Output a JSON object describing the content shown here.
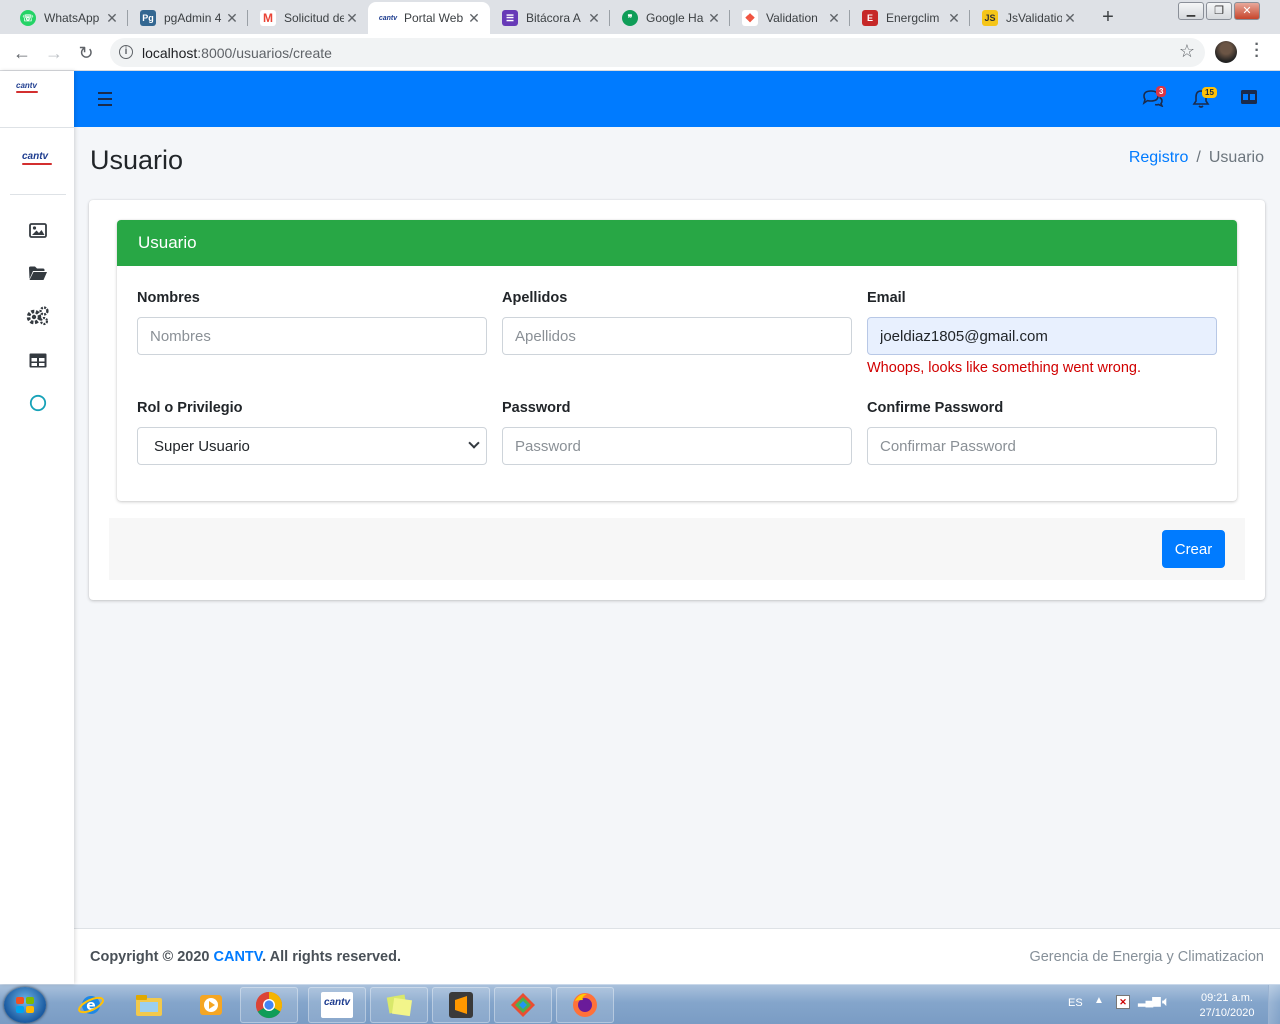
{
  "browser": {
    "tabs": [
      {
        "title": "WhatsApp",
        "icon": "whatsapp-icon",
        "color": "#25d366"
      },
      {
        "title": "pgAdmin 4",
        "icon": "pgadmin-icon",
        "color": "#336791"
      },
      {
        "title": "Solicitud de",
        "icon": "gmail-icon",
        "color": "#ea4335"
      },
      {
        "title": "Portal Web",
        "icon": "cantv-icon",
        "color": "#1d3c8f"
      },
      {
        "title": "Bitácora A",
        "icon": "forms-icon",
        "color": "#673ab7"
      },
      {
        "title": "Google Ha",
        "icon": "hangouts-icon",
        "color": "#0f9d58"
      },
      {
        "title": "Validation",
        "icon": "laravel-icon",
        "color": "#f05340"
      },
      {
        "title": "Energclim",
        "icon": "energclim-icon",
        "color": "#c62828"
      },
      {
        "title": "JsValidatio",
        "icon": "jsvalidation-icon",
        "color": "#f5c518"
      }
    ],
    "url_host": "localhost",
    "url_rest": ":8000/usuarios/create"
  },
  "brand": {
    "logo_text": "cantv"
  },
  "topnav": {
    "messages_badge": "3",
    "notifications_badge": "15"
  },
  "page": {
    "title": "Usuario",
    "breadcrumb": {
      "link": "Registro",
      "current": "Usuario"
    }
  },
  "form": {
    "header": "Usuario",
    "nombres": {
      "label": "Nombres",
      "placeholder": "Nombres",
      "value": ""
    },
    "apellidos": {
      "label": "Apellidos",
      "placeholder": "Apellidos",
      "value": ""
    },
    "email": {
      "label": "Email",
      "value": "joeldiaz1805@gmail.com",
      "error": "Whoops, looks like something went wrong."
    },
    "rol": {
      "label": "Rol o Privilegio",
      "selected": "Super Usuario"
    },
    "password": {
      "label": "Password",
      "placeholder": "Password"
    },
    "confirm": {
      "label": "Confirme Password",
      "placeholder": "Confirmar Password"
    },
    "submit": "Crear"
  },
  "footer": {
    "copyright_prefix": "Copyright © 2020 ",
    "copyright_brand": "CANTV",
    "copyright_suffix": ". All rights reserved.",
    "right": "Gerencia de Energia y Climatizacion"
  },
  "taskbar": {
    "language": "ES",
    "time": "09:21 a.m.",
    "date": "27/10/2020"
  },
  "colors": {
    "navbar": "#007bff",
    "card_header": "#28a745",
    "error": "#d10000",
    "primary": "#007bff"
  }
}
